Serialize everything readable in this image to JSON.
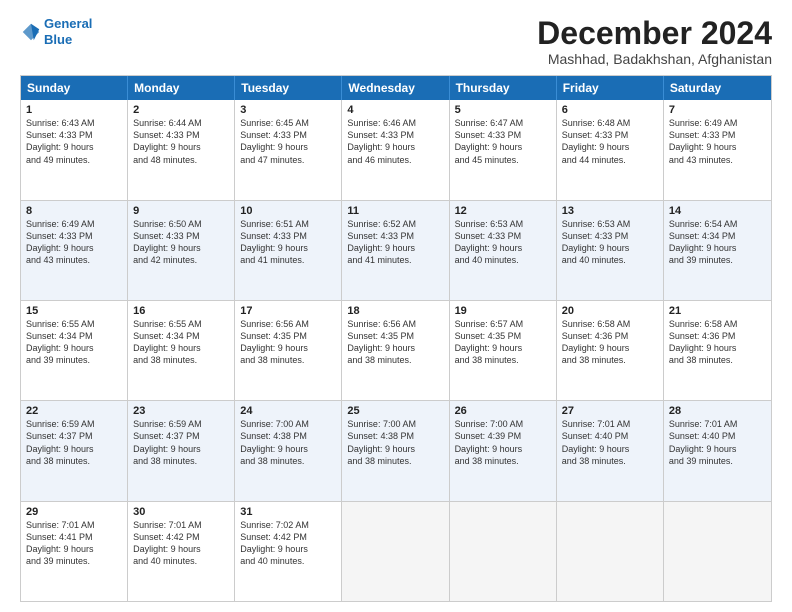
{
  "logo": {
    "line1": "General",
    "line2": "Blue"
  },
  "title": "December 2024",
  "subtitle": "Mashhad, Badakhshan, Afghanistan",
  "days": [
    "Sunday",
    "Monday",
    "Tuesday",
    "Wednesday",
    "Thursday",
    "Friday",
    "Saturday"
  ],
  "weeks": [
    [
      {
        "day": "1",
        "lines": [
          "Sunrise: 6:43 AM",
          "Sunset: 4:33 PM",
          "Daylight: 9 hours",
          "and 49 minutes."
        ]
      },
      {
        "day": "2",
        "lines": [
          "Sunrise: 6:44 AM",
          "Sunset: 4:33 PM",
          "Daylight: 9 hours",
          "and 48 minutes."
        ]
      },
      {
        "day": "3",
        "lines": [
          "Sunrise: 6:45 AM",
          "Sunset: 4:33 PM",
          "Daylight: 9 hours",
          "and 47 minutes."
        ]
      },
      {
        "day": "4",
        "lines": [
          "Sunrise: 6:46 AM",
          "Sunset: 4:33 PM",
          "Daylight: 9 hours",
          "and 46 minutes."
        ]
      },
      {
        "day": "5",
        "lines": [
          "Sunrise: 6:47 AM",
          "Sunset: 4:33 PM",
          "Daylight: 9 hours",
          "and 45 minutes."
        ]
      },
      {
        "day": "6",
        "lines": [
          "Sunrise: 6:48 AM",
          "Sunset: 4:33 PM",
          "Daylight: 9 hours",
          "and 44 minutes."
        ]
      },
      {
        "day": "7",
        "lines": [
          "Sunrise: 6:49 AM",
          "Sunset: 4:33 PM",
          "Daylight: 9 hours",
          "and 43 minutes."
        ]
      }
    ],
    [
      {
        "day": "8",
        "lines": [
          "Sunrise: 6:49 AM",
          "Sunset: 4:33 PM",
          "Daylight: 9 hours",
          "and 43 minutes."
        ]
      },
      {
        "day": "9",
        "lines": [
          "Sunrise: 6:50 AM",
          "Sunset: 4:33 PM",
          "Daylight: 9 hours",
          "and 42 minutes."
        ]
      },
      {
        "day": "10",
        "lines": [
          "Sunrise: 6:51 AM",
          "Sunset: 4:33 PM",
          "Daylight: 9 hours",
          "and 41 minutes."
        ]
      },
      {
        "day": "11",
        "lines": [
          "Sunrise: 6:52 AM",
          "Sunset: 4:33 PM",
          "Daylight: 9 hours",
          "and 41 minutes."
        ]
      },
      {
        "day": "12",
        "lines": [
          "Sunrise: 6:53 AM",
          "Sunset: 4:33 PM",
          "Daylight: 9 hours",
          "and 40 minutes."
        ]
      },
      {
        "day": "13",
        "lines": [
          "Sunrise: 6:53 AM",
          "Sunset: 4:33 PM",
          "Daylight: 9 hours",
          "and 40 minutes."
        ]
      },
      {
        "day": "14",
        "lines": [
          "Sunrise: 6:54 AM",
          "Sunset: 4:34 PM",
          "Daylight: 9 hours",
          "and 39 minutes."
        ]
      }
    ],
    [
      {
        "day": "15",
        "lines": [
          "Sunrise: 6:55 AM",
          "Sunset: 4:34 PM",
          "Daylight: 9 hours",
          "and 39 minutes."
        ]
      },
      {
        "day": "16",
        "lines": [
          "Sunrise: 6:55 AM",
          "Sunset: 4:34 PM",
          "Daylight: 9 hours",
          "and 38 minutes."
        ]
      },
      {
        "day": "17",
        "lines": [
          "Sunrise: 6:56 AM",
          "Sunset: 4:35 PM",
          "Daylight: 9 hours",
          "and 38 minutes."
        ]
      },
      {
        "day": "18",
        "lines": [
          "Sunrise: 6:56 AM",
          "Sunset: 4:35 PM",
          "Daylight: 9 hours",
          "and 38 minutes."
        ]
      },
      {
        "day": "19",
        "lines": [
          "Sunrise: 6:57 AM",
          "Sunset: 4:35 PM",
          "Daylight: 9 hours",
          "and 38 minutes."
        ]
      },
      {
        "day": "20",
        "lines": [
          "Sunrise: 6:58 AM",
          "Sunset: 4:36 PM",
          "Daylight: 9 hours",
          "and 38 minutes."
        ]
      },
      {
        "day": "21",
        "lines": [
          "Sunrise: 6:58 AM",
          "Sunset: 4:36 PM",
          "Daylight: 9 hours",
          "and 38 minutes."
        ]
      }
    ],
    [
      {
        "day": "22",
        "lines": [
          "Sunrise: 6:59 AM",
          "Sunset: 4:37 PM",
          "Daylight: 9 hours",
          "and 38 minutes."
        ]
      },
      {
        "day": "23",
        "lines": [
          "Sunrise: 6:59 AM",
          "Sunset: 4:37 PM",
          "Daylight: 9 hours",
          "and 38 minutes."
        ]
      },
      {
        "day": "24",
        "lines": [
          "Sunrise: 7:00 AM",
          "Sunset: 4:38 PM",
          "Daylight: 9 hours",
          "and 38 minutes."
        ]
      },
      {
        "day": "25",
        "lines": [
          "Sunrise: 7:00 AM",
          "Sunset: 4:38 PM",
          "Daylight: 9 hours",
          "and 38 minutes."
        ]
      },
      {
        "day": "26",
        "lines": [
          "Sunrise: 7:00 AM",
          "Sunset: 4:39 PM",
          "Daylight: 9 hours",
          "and 38 minutes."
        ]
      },
      {
        "day": "27",
        "lines": [
          "Sunrise: 7:01 AM",
          "Sunset: 4:40 PM",
          "Daylight: 9 hours",
          "and 38 minutes."
        ]
      },
      {
        "day": "28",
        "lines": [
          "Sunrise: 7:01 AM",
          "Sunset: 4:40 PM",
          "Daylight: 9 hours",
          "and 39 minutes."
        ]
      }
    ],
    [
      {
        "day": "29",
        "lines": [
          "Sunrise: 7:01 AM",
          "Sunset: 4:41 PM",
          "Daylight: 9 hours",
          "and 39 minutes."
        ]
      },
      {
        "day": "30",
        "lines": [
          "Sunrise: 7:01 AM",
          "Sunset: 4:42 PM",
          "Daylight: 9 hours",
          "and 40 minutes."
        ]
      },
      {
        "day": "31",
        "lines": [
          "Sunrise: 7:02 AM",
          "Sunset: 4:42 PM",
          "Daylight: 9 hours",
          "and 40 minutes."
        ]
      },
      {
        "day": "",
        "lines": []
      },
      {
        "day": "",
        "lines": []
      },
      {
        "day": "",
        "lines": []
      },
      {
        "day": "",
        "lines": []
      }
    ]
  ]
}
